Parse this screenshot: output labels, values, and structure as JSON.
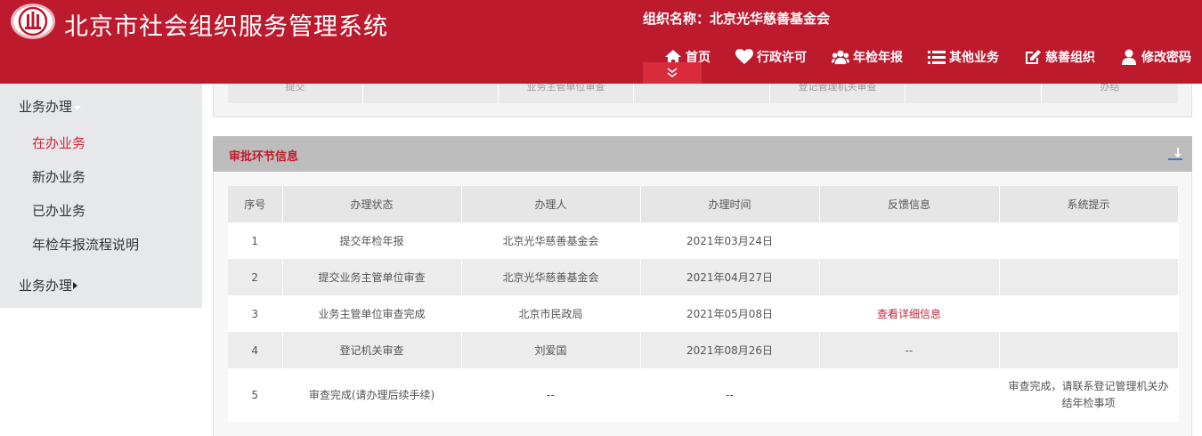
{
  "header": {
    "system_title": "北京市社会组织服务管理系统",
    "org_name": "组织名称：北京光华慈善基金会",
    "nav": [
      {
        "label": "首页",
        "icon": "home-icon"
      },
      {
        "label": "行政许可",
        "icon": "heart-icon"
      },
      {
        "label": "年检年报",
        "icon": "users-icon"
      },
      {
        "label": "其他业务",
        "icon": "list-icon"
      },
      {
        "label": "慈善组织",
        "icon": "edit-icon"
      },
      {
        "label": "修改密码",
        "icon": "user-icon"
      }
    ]
  },
  "sidebar": {
    "group1": "业务办理",
    "items": [
      "在办业务",
      "新办业务",
      "已办业务",
      "年检年报流程说明"
    ],
    "active_item": "在办业务",
    "group2": "业务办理"
  },
  "top_panel": {
    "cells": [
      "提交",
      "",
      "业务主管单位审查",
      "",
      "登记管理机关审查",
      "",
      "办结"
    ]
  },
  "approval": {
    "title": "审批环节信息",
    "columns": [
      "序号",
      "办理状态",
      "办理人",
      "办理时间",
      "反馈信息",
      "系统提示"
    ],
    "rows": [
      {
        "no": "1",
        "status": "提交年检年报",
        "handler": "北京光华慈善基金会",
        "time": "2021年03月24日",
        "feedback": "",
        "hint": ""
      },
      {
        "no": "2",
        "status": "提交业务主管单位审查",
        "handler": "北京光华慈善基金会",
        "time": "2021年04月27日",
        "feedback": "",
        "hint": ""
      },
      {
        "no": "3",
        "status": "业务主管单位审查完成",
        "handler": "北京市民政局",
        "time": "2021年05月08日",
        "feedback": "查看详细信息",
        "hint": ""
      },
      {
        "no": "4",
        "status": "登记机关审查",
        "handler": "刘爱国",
        "time": "2021年08月26日",
        "feedback": "--",
        "hint": ""
      },
      {
        "no": "5",
        "status": "审查完成(请办理后续手续)",
        "handler": "--",
        "time": "--",
        "feedback": "",
        "hint": "审查完成，请联系登记管理机关办结年检事项"
      }
    ]
  },
  "colors": {
    "brand_red": "#be1a2e",
    "active_red": "#d0283a",
    "section_gray": "#bdbdbd"
  }
}
